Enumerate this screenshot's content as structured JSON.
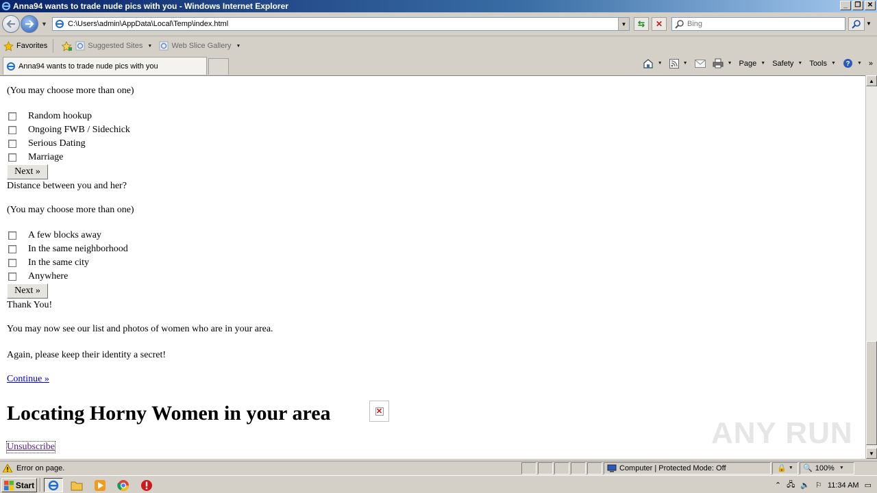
{
  "window": {
    "title": "Anna94 wants to trade nude pics with you - Windows Internet Explorer",
    "minimize": "_",
    "restore": "❐",
    "close": "✕"
  },
  "address_bar": {
    "url": "C:\\Users\\admin\\AppData\\Local\\Temp\\index.html",
    "search_placeholder": "Bing"
  },
  "favorites_bar": {
    "favorites_label": "Favorites",
    "items": [
      {
        "label": "Suggested Sites"
      },
      {
        "label": "Web Slice Gallery"
      }
    ]
  },
  "tabs": [
    {
      "label": "Anna94 wants to trade nude pics with you"
    }
  ],
  "command_bar": {
    "page_label": "Page",
    "safety_label": "Safety",
    "tools_label": "Tools"
  },
  "content": {
    "choose_more_1": "(You may choose more than one)",
    "options_1": [
      "Random hookup",
      "Ongoing FWB / Sidechick",
      "Serious Dating",
      "Marriage"
    ],
    "next_label": "Next »",
    "distance_question": "Distance between you and her?",
    "choose_more_2": "(You may choose more than one)",
    "options_2": [
      "A few blocks away",
      "In the same neighborhood",
      "In the same city",
      "Anywhere"
    ],
    "thank_you": "Thank You!",
    "see_list": "You may now see our list and photos of women who are in your area.",
    "keep_secret": "Again, please keep their identity a secret!",
    "continue_link": "Continue »",
    "heading": "Locating Horny Women in your area",
    "unsubscribe_link": "Unsubscribe",
    "watermark": "ANY RUN"
  },
  "status_bar": {
    "error_text": "Error on page.",
    "zone_text": "Computer | Protected Mode: Off",
    "zoom": "100%"
  },
  "taskbar": {
    "start_label": "Start",
    "clock": "11:34 AM"
  }
}
